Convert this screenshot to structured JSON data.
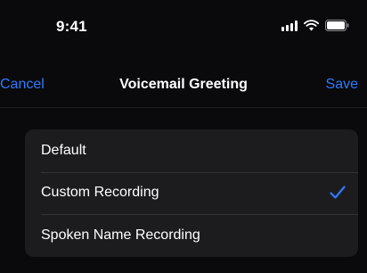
{
  "status_bar": {
    "time": "9:41",
    "icons": [
      "signal-icon",
      "wifi-icon",
      "battery-icon"
    ]
  },
  "nav": {
    "cancel_label": "Cancel",
    "title": "Voicemail Greeting",
    "save_label": "Save"
  },
  "options": {
    "items": [
      {
        "label": "Default",
        "selected": false
      },
      {
        "label": "Custom Recording",
        "selected": true
      },
      {
        "label": "Spoken Name Recording",
        "selected": false
      }
    ]
  },
  "colors": {
    "accent": "#2f7bff",
    "background": "#0a0a0c",
    "group_background": "#1c1c1e"
  }
}
